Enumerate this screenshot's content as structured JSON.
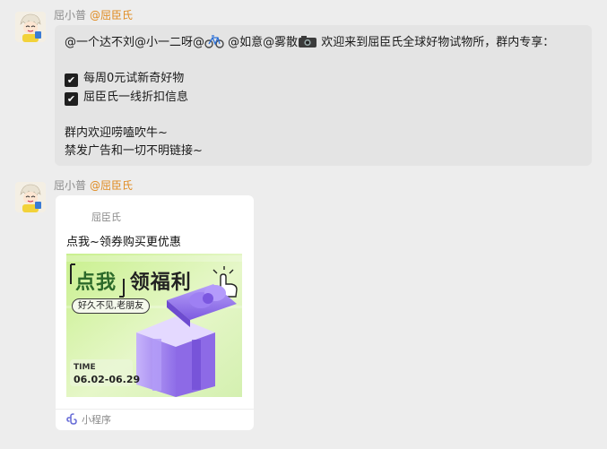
{
  "messages": [
    {
      "sender": "屈小普",
      "at": "@屈臣氏",
      "text": {
        "line1_prefix": "@一个达不刘@小一二呀@",
        "line1_mid": " @如意@雾散",
        "line1_suffix": " 欢迎来到屈臣氏全球好物试物所，群内专享：",
        "bullets": [
          "每周0元试新奇好物",
          "屈臣氏一线折扣信息"
        ],
        "line_welcome": "群内欢迎唠嗑吹牛~",
        "line_ban": "禁发广告和一切不明链接~"
      }
    },
    {
      "sender": "屈小普",
      "at": "@屈臣氏",
      "card": {
        "source": "屈臣氏",
        "title": "点我~领券购买更优惠",
        "cover": {
          "headline_left": "点我",
          "headline_right": "领福利",
          "tag": "好久不见,老朋友",
          "time_label": "TIME",
          "dates": "06.02-06.29"
        },
        "footer": "小程序"
      }
    }
  ],
  "icons": {
    "checkbox": "checked-box-icon",
    "bike": "bicycle-icon",
    "camera": "camera-icon",
    "miniprogram": "mini-program-icon"
  },
  "colors": {
    "bubble": "#e4e4e4",
    "at_mention": "#e08a1e",
    "gift_purple": "#a98bf2",
    "cover_green": "#d7f2a5"
  }
}
